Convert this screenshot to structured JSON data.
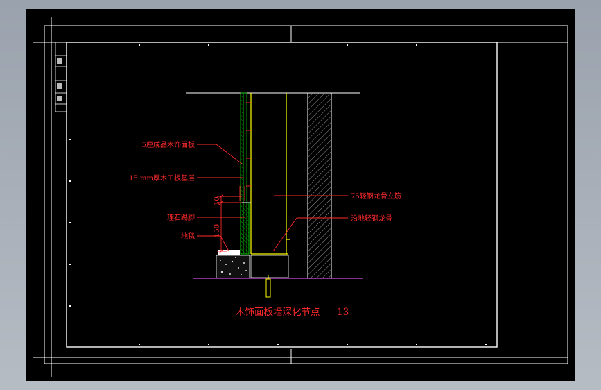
{
  "drawing": {
    "title": "木饰面板墙深化节点",
    "title_number": "13",
    "callouts": {
      "wood_panel": "5厘成品木饰面板",
      "plywood_base": "15 mm厚木工板基层",
      "marble_skirting": "理石踢脚",
      "floor_tile": "地毯",
      "steel_stud": "75轻钢龙骨立筋",
      "floor_track": "沿地轻钢龙骨"
    },
    "dimensions": {
      "top_gap": "10",
      "skirting_height": "150"
    }
  },
  "colors": {
    "background": "#000000",
    "annotation": "#ff2a2a",
    "frame": "#ffffff",
    "stud": "#ffff00",
    "panel": "#00c800",
    "floor": "#b040c0",
    "hatch": "#a0a0a0"
  }
}
